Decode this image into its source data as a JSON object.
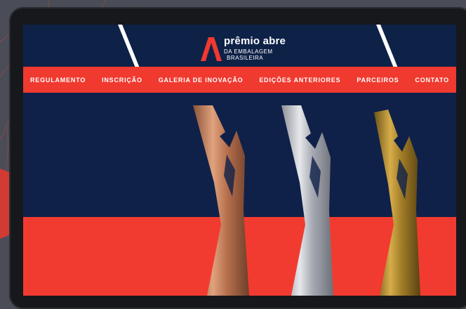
{
  "logo": {
    "title": "prêmio abre",
    "subtitle_line1": "DA EMBALAGEM",
    "subtitle_line2": "BRASILEIRA"
  },
  "nav": {
    "items": [
      {
        "label": "REGULAMENTO"
      },
      {
        "label": "INSCRIÇÃO"
      },
      {
        "label": "GALERIA DE INOVAÇÃO"
      },
      {
        "label": "EDIÇÕES ANTERIORES"
      },
      {
        "label": "PARCEIROS"
      },
      {
        "label": "CONTATO"
      }
    ]
  },
  "colors": {
    "navy": "#0e2147",
    "accent_red": "#f0392f",
    "bronze": "#c9865e",
    "silver": "#b9bcc4",
    "gold": "#b48a2c"
  },
  "hero": {
    "trophies": [
      "bronze-trophy",
      "silver-trophy",
      "gold-trophy"
    ]
  }
}
